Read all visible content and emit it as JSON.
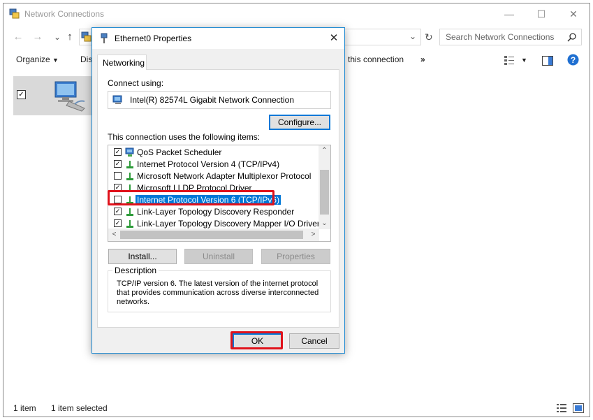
{
  "explorer": {
    "title": "Network Connections",
    "search_placeholder": "Search Network Connections",
    "cmd": {
      "organize": "Organize",
      "dis": "Dis",
      "this_connection": "this connection",
      "more": "»"
    },
    "status": {
      "count": "1 item",
      "selected": "1 item selected"
    }
  },
  "dialog": {
    "title": "Ethernet0 Properties",
    "tab": "Networking",
    "connect_using_label": "Connect using:",
    "adapter": "Intel(R) 82574L Gigabit Network Connection",
    "configure_label": "Configure...",
    "items_label": "This connection uses the following items:",
    "items": [
      {
        "label": "QoS Packet Scheduler",
        "checked": true,
        "icon": "qos-icon"
      },
      {
        "label": "Internet Protocol Version 4 (TCP/IPv4)",
        "checked": true,
        "icon": "protocol-icon"
      },
      {
        "label": "Microsoft Network Adapter Multiplexor Protocol",
        "checked": false,
        "icon": "protocol-icon"
      },
      {
        "label": "Microsoft LLDP Protocol Driver",
        "checked": true,
        "icon": "protocol-icon"
      },
      {
        "label": "Internet Protocol Version 6 (TCP/IPv6)",
        "checked": false,
        "icon": "protocol-icon",
        "selected": true
      },
      {
        "label": "Link-Layer Topology Discovery Responder",
        "checked": true,
        "icon": "protocol-icon"
      },
      {
        "label": "Link-Layer Topology Discovery Mapper I/O Driver",
        "checked": true,
        "icon": "protocol-icon"
      }
    ],
    "install_label": "Install...",
    "uninstall_label": "Uninstall",
    "properties_label": "Properties",
    "description_legend": "Description",
    "description_text": "TCP/IP version 6. The latest version of the internet protocol that provides communication across diverse interconnected networks.",
    "ok_label": "OK",
    "cancel_label": "Cancel",
    "colors": {
      "selection": "#0078d7",
      "highlight_box": "#e0121b",
      "accent_border": "#1f8ad2"
    }
  }
}
